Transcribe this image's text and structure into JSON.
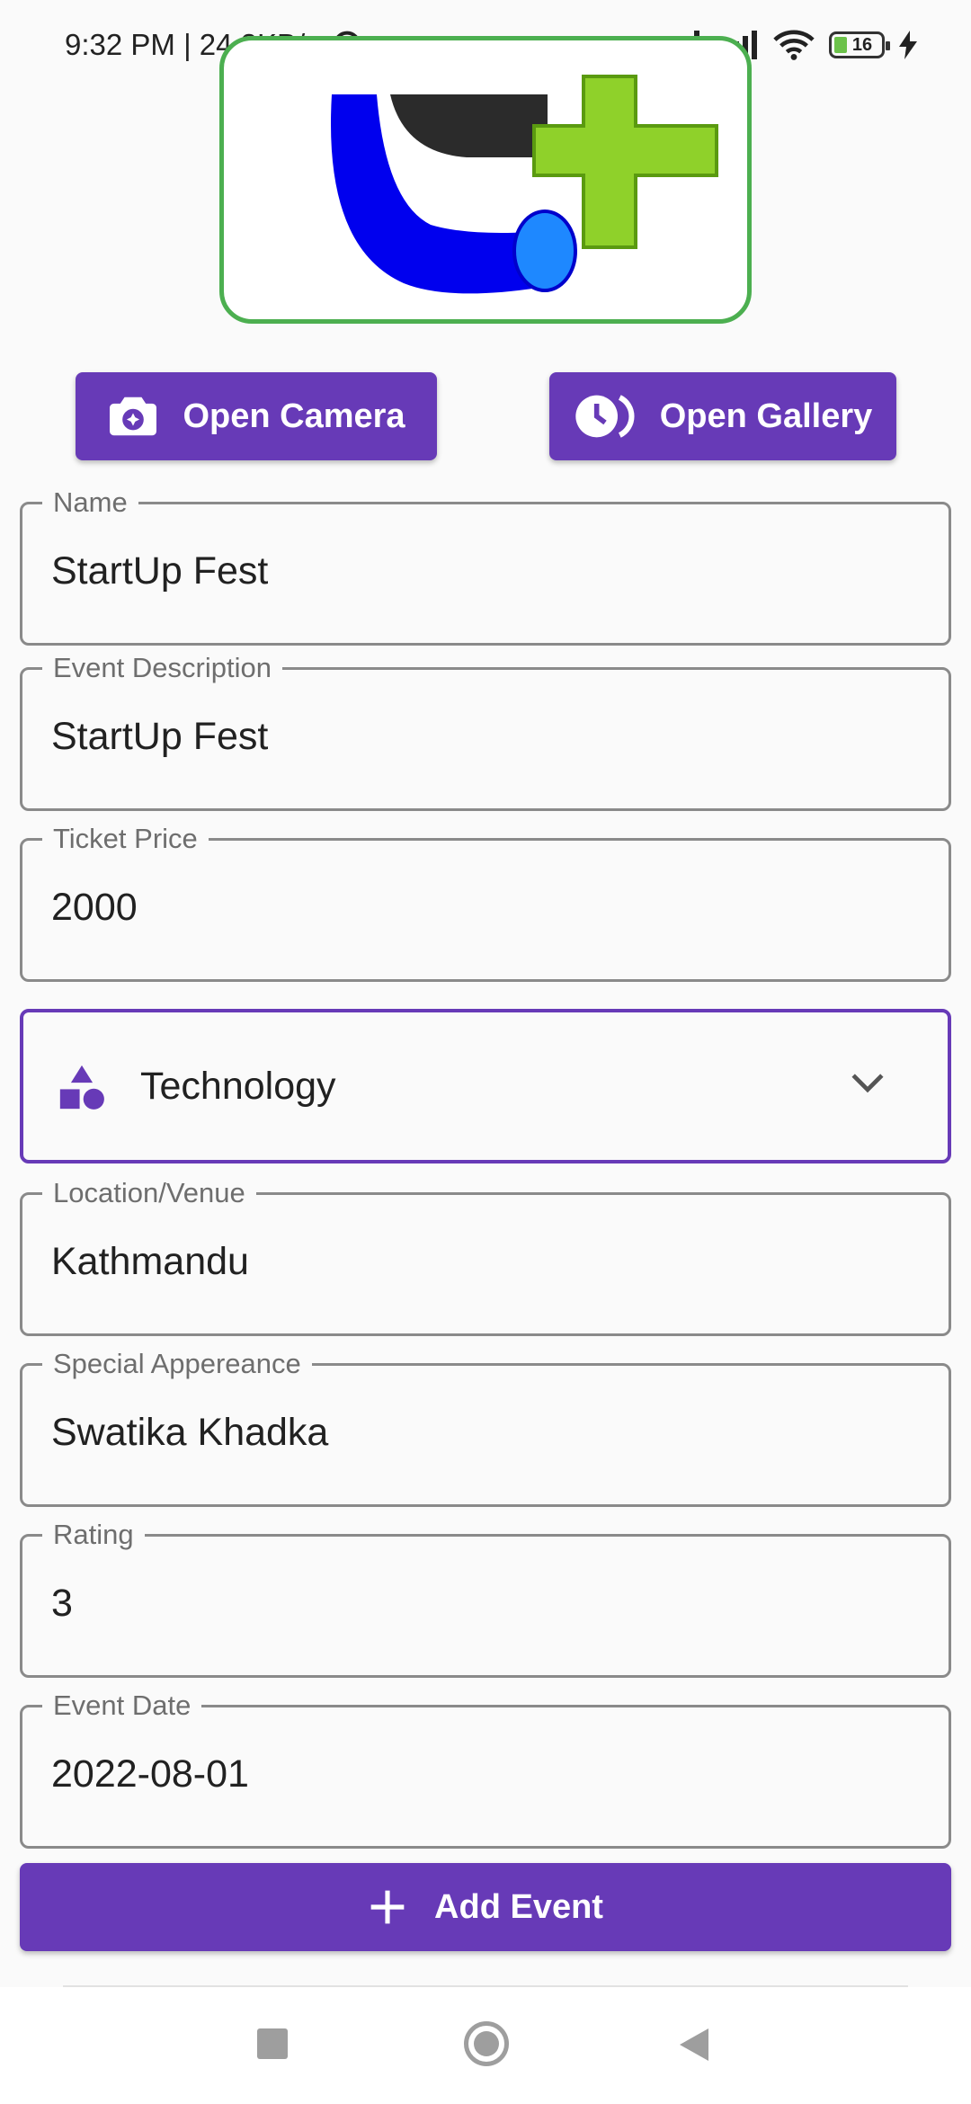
{
  "status_bar": {
    "time_speed": "9:32 PM | 24.2KB/s",
    "battery_level": "16"
  },
  "media_buttons": {
    "camera_label": "Open Camera",
    "gallery_label": "Open Gallery"
  },
  "fields": {
    "name": {
      "label": "Name",
      "value": "StartUp Fest"
    },
    "description": {
      "label": "Event Description",
      "value": "StartUp Fest"
    },
    "price": {
      "label": "Ticket Price",
      "value": "2000"
    },
    "location": {
      "label": "Location/Venue",
      "value": "Kathmandu"
    },
    "special": {
      "label": "Special Appereance",
      "value": "Swatika Khadka"
    },
    "rating": {
      "label": "Rating",
      "value": "3"
    },
    "date": {
      "label": "Event Date",
      "value": "2022-08-01"
    }
  },
  "category": {
    "selected": "Technology",
    "icon": "category-icon"
  },
  "submit": {
    "label": "Add Event",
    "icon": "plus-icon"
  },
  "colors": {
    "primary": "#673ab7",
    "image_border": "#4caf50",
    "field_border": "#8a8a8a"
  }
}
